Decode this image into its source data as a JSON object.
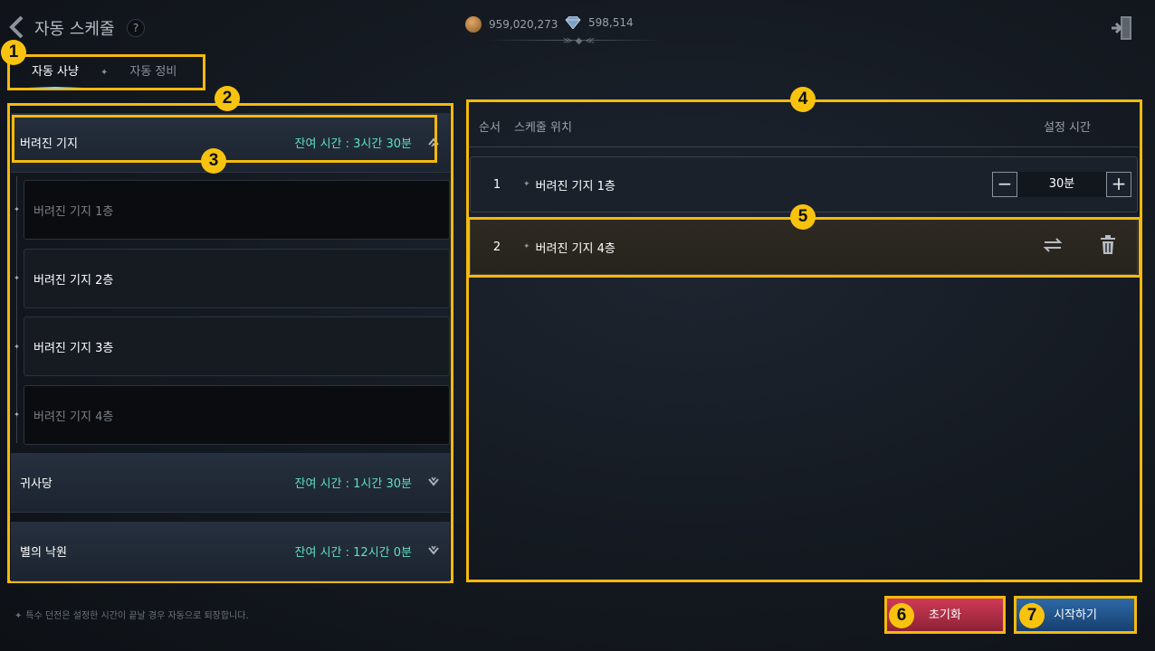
{
  "header": {
    "title": "자동 스케줄",
    "help": "?",
    "gold": "959,020,273",
    "diamond": "598,514"
  },
  "tabs": [
    {
      "label": "자동 사냥"
    },
    {
      "label": "자동 정비"
    }
  ],
  "tab_separator": "✦",
  "left": {
    "groups": [
      {
        "name": "버려진 기지",
        "time": "잔여 시간 : 3시간 30분",
        "expanded": true
      },
      {
        "name": "귀사당",
        "time": "잔여 시간 : 1시간 30분",
        "expanded": false
      },
      {
        "name": "별의 낙원",
        "time": "잔여 시간 : 12시간 0분",
        "expanded": false
      }
    ],
    "floors": [
      {
        "label": "버려진 기지 1층",
        "state": "dim"
      },
      {
        "label": "버려진 기지 2층",
        "state": "bright"
      },
      {
        "label": "버려진 기지 3층",
        "state": "bright"
      },
      {
        "label": "버려진 기지 4층",
        "state": "dim"
      }
    ]
  },
  "right": {
    "col_order": "순서",
    "col_location": "스케줄 위치",
    "col_time": "설정 시간",
    "rows": [
      {
        "index": "1",
        "location": "버려진 기지 1층",
        "duration": "30분"
      },
      {
        "index": "2",
        "location": "버려진 기지 4층"
      }
    ]
  },
  "footnote": "특수 던전은 설정한 시간이 끝날 경우 자동으로 퇴장합니다.",
  "buttons": {
    "reset": "초기화",
    "start": "시작하기"
  },
  "annotations": [
    "1",
    "2",
    "3",
    "4",
    "5",
    "6",
    "7"
  ],
  "colors": {
    "highlight": "#f5b90e",
    "time_text": "#5ee0c0",
    "reset": "#d03a56",
    "start": "#2e6aa8"
  }
}
